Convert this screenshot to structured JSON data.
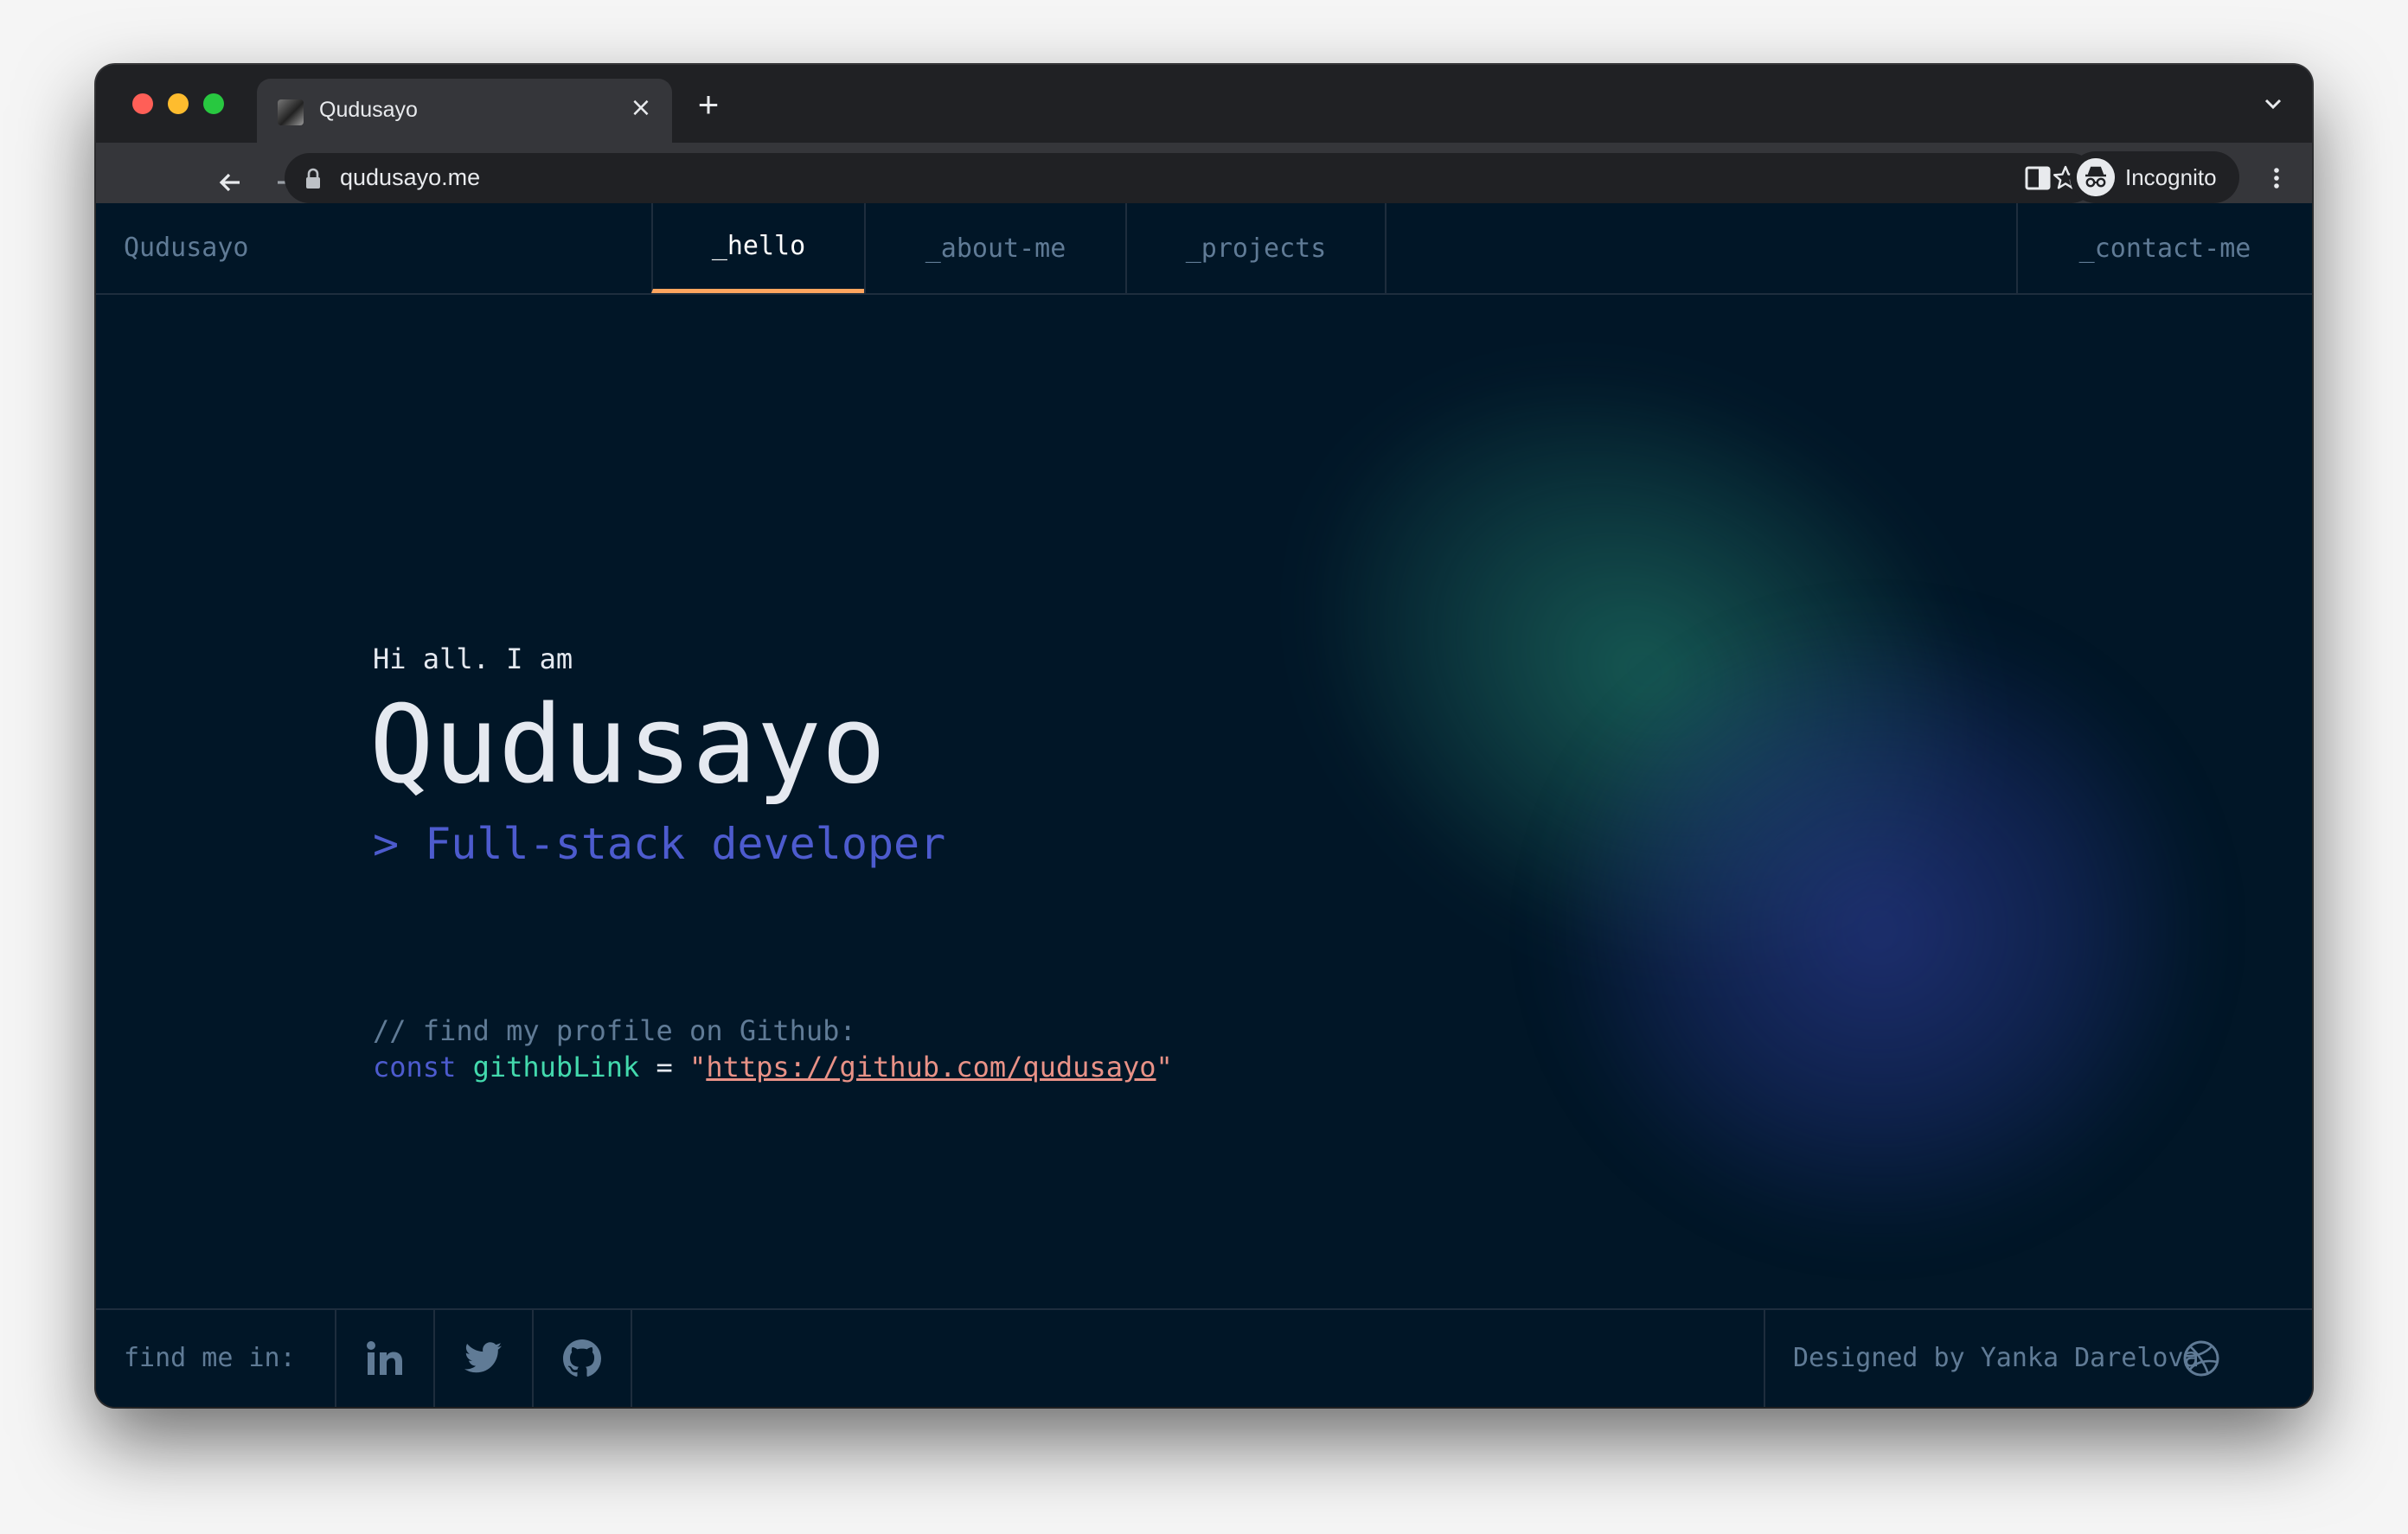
{
  "browser": {
    "tab_title": "Qudusayo",
    "tab_close": "×",
    "new_tab": "+",
    "url": "qudusayo.me",
    "profile_label": "Incognito",
    "icons": [
      "back-icon",
      "forward-icon",
      "reload-icon",
      "lock-icon",
      "star-icon",
      "side-panel-icon",
      "incognito-icon",
      "kebab-menu-icon",
      "tab-menu-chevron-icon"
    ]
  },
  "site": {
    "brand": "Qudusayo",
    "nav": {
      "hello": "_hello",
      "about": "_about-me",
      "projects": "_projects",
      "contact": "_contact-me",
      "active": "_hello"
    },
    "hero": {
      "greeting": "Hi all. I am",
      "name": "Qudusayo",
      "role": "> Full-stack developer"
    },
    "code": {
      "comment": "// find my profile on Github:",
      "keyword": "const",
      "variable": "githubLink",
      "operator": "=",
      "quote_open": "\"",
      "link": "https://github.com/qudusayo",
      "quote_close": "\""
    },
    "footer": {
      "find_label": "find me in:",
      "socials": [
        "linkedin-icon",
        "twitter-icon",
        "github-icon"
      ],
      "credit": "Designed by Yanka Darelova",
      "credit_icon": "dribbble-icon"
    },
    "colors": {
      "background": "#011627",
      "border": "#1e2d3d",
      "muted": "#607b96",
      "accent_orange": "#fea55f",
      "accent_blue": "#4d5bce",
      "accent_green": "#43d9ad",
      "string": "#e99287"
    }
  }
}
